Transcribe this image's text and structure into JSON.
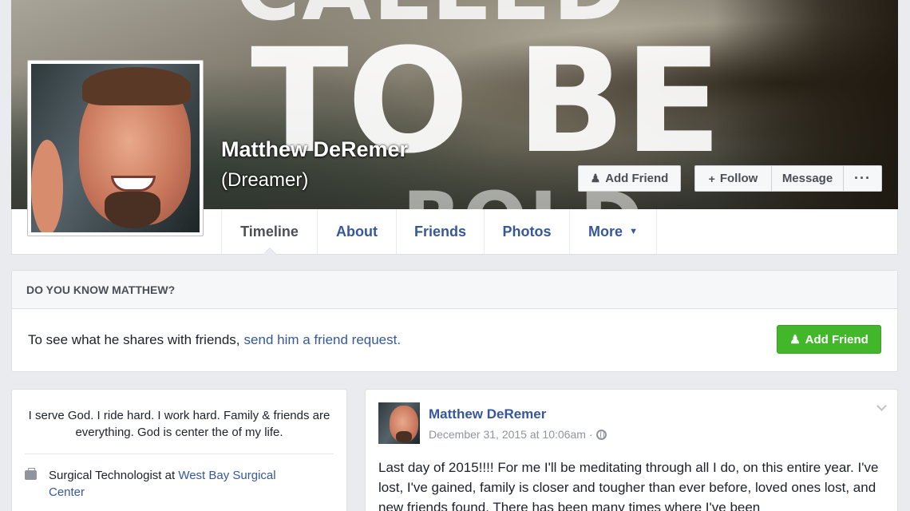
{
  "cover": {
    "text_line1": "CALLED",
    "text_line2": "TO BE",
    "text_line3": "BOLD"
  },
  "profile": {
    "name": "Matthew DeRemer",
    "alternate_name": "(Dreamer)"
  },
  "actions": {
    "add_friend": "Add Friend",
    "follow": "Follow",
    "message": "Message",
    "more": "···"
  },
  "tabs": [
    {
      "label": "Timeline",
      "active": true
    },
    {
      "label": "About"
    },
    {
      "label": "Friends"
    },
    {
      "label": "Photos"
    },
    {
      "label": "More"
    }
  ],
  "know_box": {
    "heading": "DO YOU KNOW MATTHEW?",
    "text": "To see what he shares with friends,",
    "link": "send him a friend request.",
    "button": "Add Friend"
  },
  "intro": {
    "bio": "I serve God. I ride hard. I work hard. Family & friends are everything. God is center the of my life.",
    "work_title": "Surgical Technologist at",
    "work_place": "West Bay Surgical Center"
  },
  "post": {
    "author": "Matthew DeRemer",
    "timestamp": "December 31, 2015 at 10:06am",
    "separator": "·",
    "text": "Last day of 2015!!!! For me I'll be meditating through all I do, on this entire year. I've lost, I've gained, family is closer and tougher than ever before, loved ones lost, and new friends found. There has been many times where I've been"
  },
  "colors": {
    "link_blue": "#365899",
    "green_button": "#42b72a",
    "page_bg": "#e9ebee"
  }
}
